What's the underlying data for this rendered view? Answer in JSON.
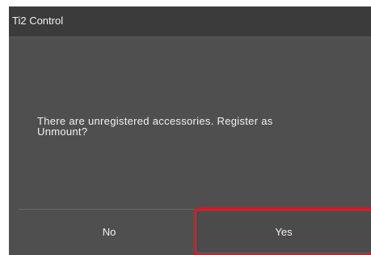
{
  "window": {
    "title": "Ti2 Control"
  },
  "dialog": {
    "message_line1": "There are unregistered accessories. Register as",
    "message_line2": "Unmount?"
  },
  "buttons": {
    "no_label": "No",
    "yes_label": "Yes"
  },
  "colors": {
    "background": "#4f4f4f",
    "title_bar": "#3b3b3b",
    "text": "#f2f2f2",
    "highlight": "#e0141e"
  }
}
